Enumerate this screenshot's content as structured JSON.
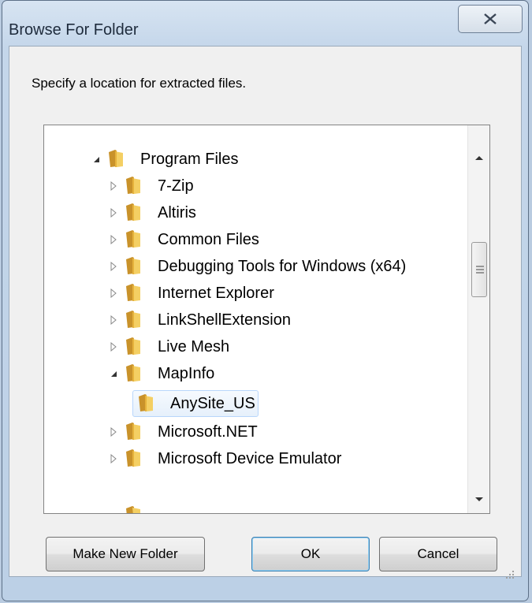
{
  "window": {
    "title": "Browse For Folder"
  },
  "instruction": "Specify a location for extracted files.",
  "tree": {
    "items": [
      {
        "label": "Program Files",
        "expanded": true
      },
      {
        "label": "7-Zip",
        "expanded": false
      },
      {
        "label": "Altiris",
        "expanded": false
      },
      {
        "label": "Common Files",
        "expanded": false
      },
      {
        "label": "Debugging Tools for Windows (x64)",
        "expanded": false
      },
      {
        "label": "Internet Explorer",
        "expanded": false
      },
      {
        "label": "LinkShellExtension",
        "expanded": false
      },
      {
        "label": "Live Mesh",
        "expanded": false
      },
      {
        "label": "MapInfo",
        "expanded": true
      },
      {
        "label": "AnySite_US",
        "selected": true
      },
      {
        "label": "Microsoft.NET",
        "expanded": false
      },
      {
        "label": "Microsoft Device Emulator",
        "expanded": false
      }
    ]
  },
  "buttons": {
    "new_folder": "Make New Folder",
    "ok": "OK",
    "cancel": "Cancel"
  },
  "icons": {
    "close": "close-icon",
    "folder": "folder-icon",
    "expand": "expand-arrow-icon",
    "collapse": "collapse-arrow-icon"
  },
  "colors": {
    "selection_fill": "#e6f0fb",
    "selection_border": "#b8d6fb",
    "folder": "#e8b93b"
  }
}
